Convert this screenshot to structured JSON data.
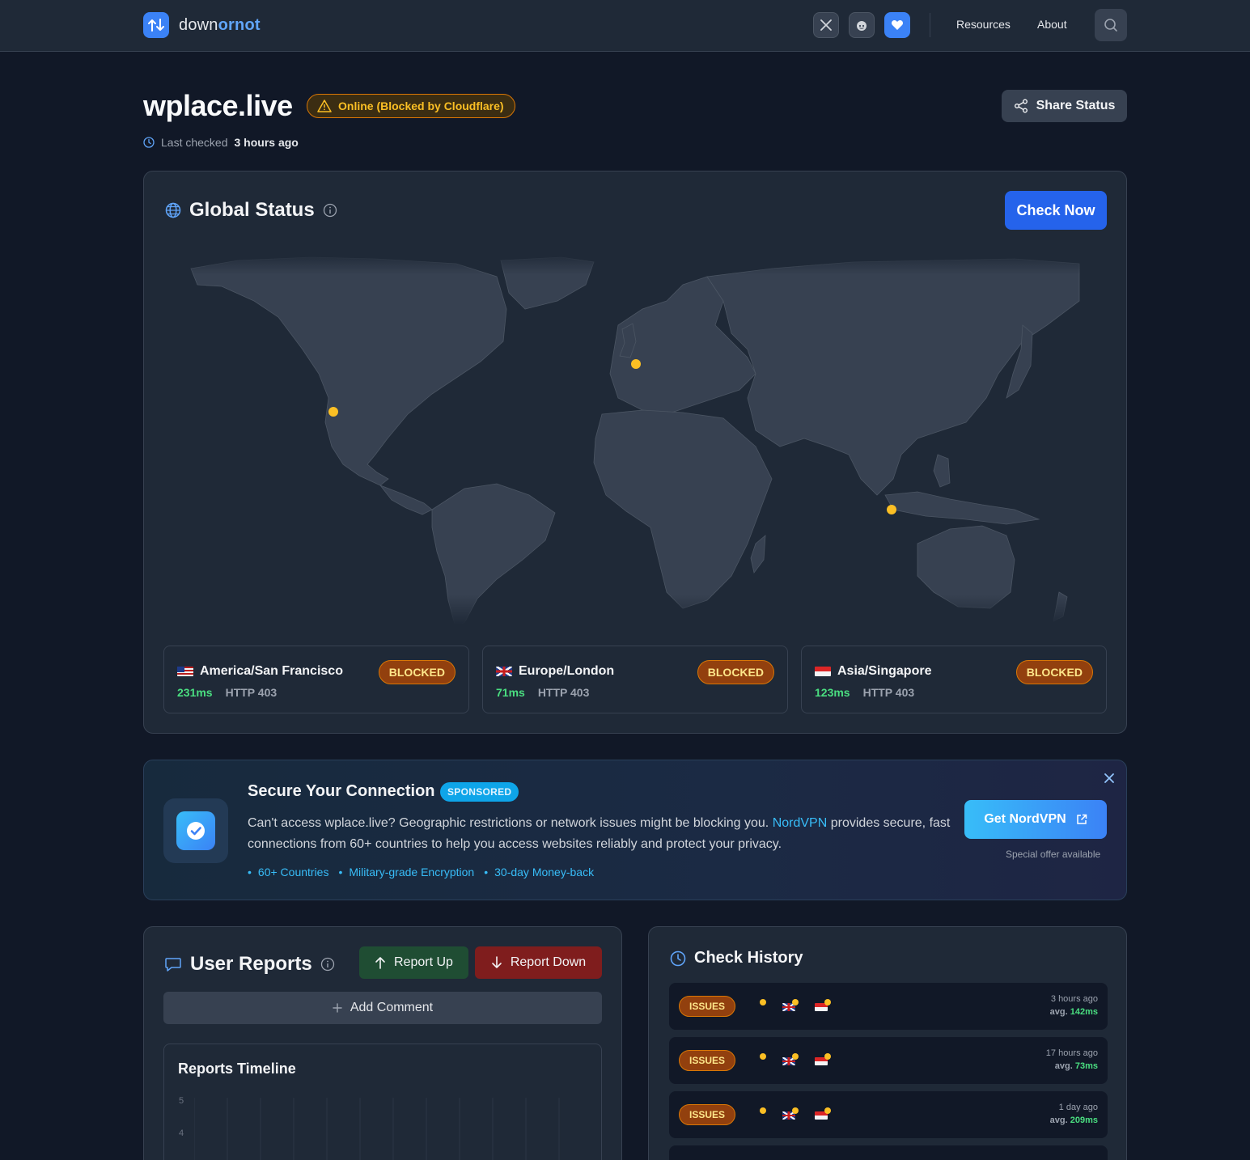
{
  "header": {
    "brand_prefix": "down",
    "brand_accent": "ornot",
    "nav": [
      "Resources",
      "About"
    ],
    "social_icons": [
      "x-icon",
      "reddit-icon",
      "heart-icon"
    ]
  },
  "site": {
    "name": "wplace.live",
    "status": "Online (Blocked by Cloudflare)",
    "last_checked_prefix": "Last checked",
    "last_checked_value": "3 hours ago",
    "share_label": "Share Status"
  },
  "global_status": {
    "title": "Global Status",
    "check_now": "Check Now",
    "locations": [
      {
        "name": "America/San Francisco",
        "flag": "us",
        "latency": "231ms",
        "http": "HTTP 403",
        "status": "BLOCKED"
      },
      {
        "name": "Europe/London",
        "flag": "uk",
        "latency": "71ms",
        "http": "HTTP 403",
        "status": "BLOCKED"
      },
      {
        "name": "Asia/Singapore",
        "flag": "sg",
        "latency": "123ms",
        "http": "HTTP 403",
        "status": "BLOCKED"
      }
    ]
  },
  "sponsored": {
    "title": "Secure Your Connection",
    "badge": "SPONSORED",
    "text_before": "Can't access wplace.live? Geographic restrictions or network issues might be blocking you.",
    "brand": "NordVPN",
    "text_after": "provides secure, fast connections from 60+ countries to help you access websites reliably and protect your privacy.",
    "features": [
      "60+ Countries",
      "Military-grade Encryption",
      "30-day Money-back"
    ],
    "cta": "Get NordVPN",
    "offer": "Special offer available"
  },
  "user_reports": {
    "title": "User Reports",
    "report_up": "Report Up",
    "report_down": "Report Down",
    "add_comment": "Add Comment",
    "timeline_title": "Reports Timeline",
    "y_ticks": [
      "5",
      "4"
    ]
  },
  "check_history": {
    "title": "Check History",
    "rows": [
      {
        "status": "ISSUES",
        "time": "3 hours ago",
        "avg_label": "avg.",
        "avg": "142ms"
      },
      {
        "status": "ISSUES",
        "time": "17 hours ago",
        "avg_label": "avg.",
        "avg": "73ms"
      },
      {
        "status": "ISSUES",
        "time": "1 day ago",
        "avg_label": "avg.",
        "avg": "209ms"
      }
    ]
  },
  "colors": {
    "background": "#111827",
    "card": "#1f2937",
    "accent": "#3b82f6",
    "warning": "#fbbf24",
    "success": "#4ade80"
  }
}
